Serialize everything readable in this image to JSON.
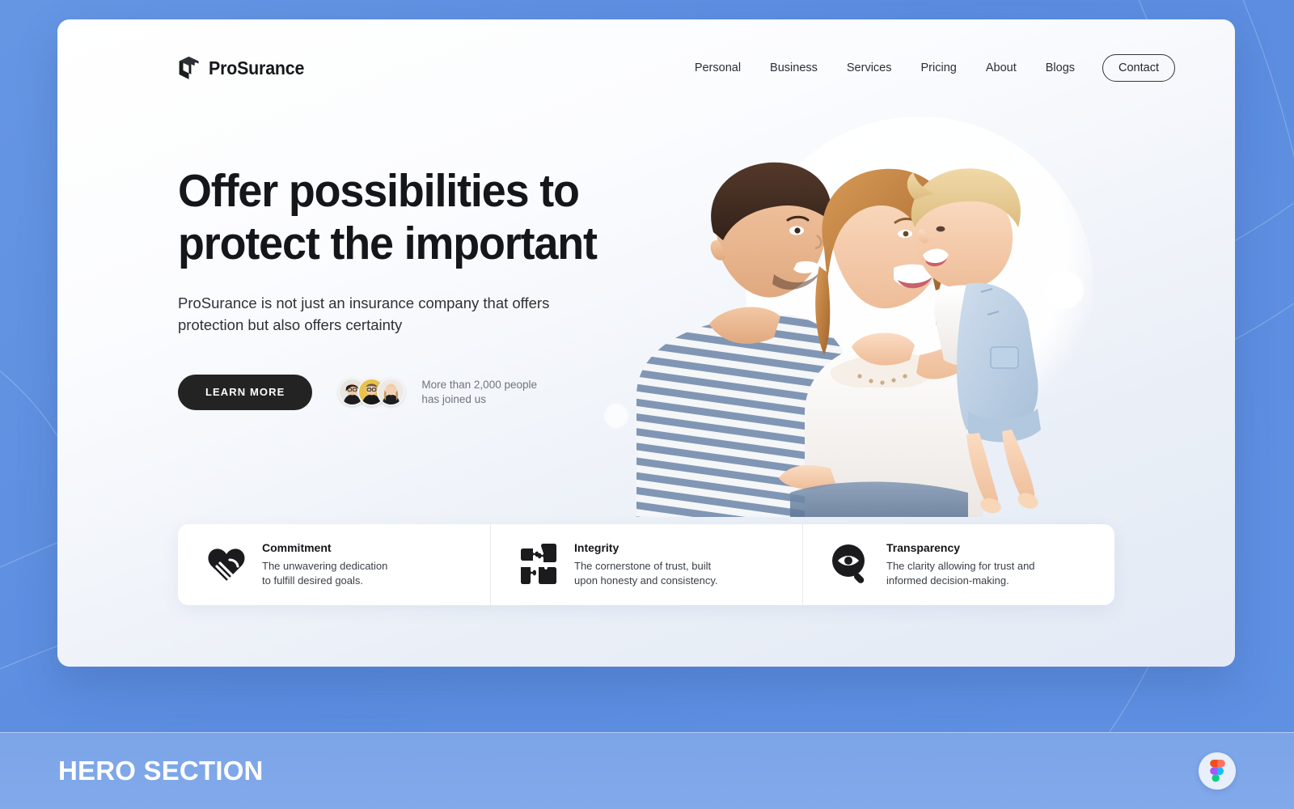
{
  "brand": {
    "name": "ProSurance",
    "logo_icon": "cube-box-icon"
  },
  "nav": {
    "items": [
      {
        "label": "Personal"
      },
      {
        "label": "Business"
      },
      {
        "label": "Services"
      },
      {
        "label": "Pricing"
      },
      {
        "label": "About"
      },
      {
        "label": "Blogs"
      }
    ],
    "contact_label": "Contact"
  },
  "hero": {
    "headline_line1": "Offer possibilities to",
    "headline_line2": "protect the important",
    "subhead": "ProSurance is not just an insurance company that offers protection but also offers certainty",
    "cta_label": "LEARN MORE",
    "social_proof_line1": "More than 2,000 people",
    "social_proof_line2": "has joined us",
    "image_alt": "family-photo-father-mother-baby"
  },
  "features": [
    {
      "icon": "heart-hand-icon",
      "title": "Commitment",
      "desc_line1": "The unwavering dedication",
      "desc_line2": "to fulfill desired goals."
    },
    {
      "icon": "puzzle-pieces-icon",
      "title": "Integrity",
      "desc_line1": "The cornerstone of trust, built",
      "desc_line2": "upon honesty and consistency."
    },
    {
      "icon": "magnifier-eye-icon",
      "title": "Transparency",
      "desc_line1": "The clarity allowing for trust and",
      "desc_line2": "informed decision-making."
    }
  ],
  "footer": {
    "caption": "HERO SECTION",
    "badge_icon": "figma-logo-icon"
  },
  "colors": {
    "backdrop_blue": "#5b8cdf",
    "caption_bar_blue": "#7ba5e8",
    "card_white": "#ffffff",
    "ink": "#141619",
    "muted": "#6f757f",
    "cta_dark": "#232323"
  }
}
